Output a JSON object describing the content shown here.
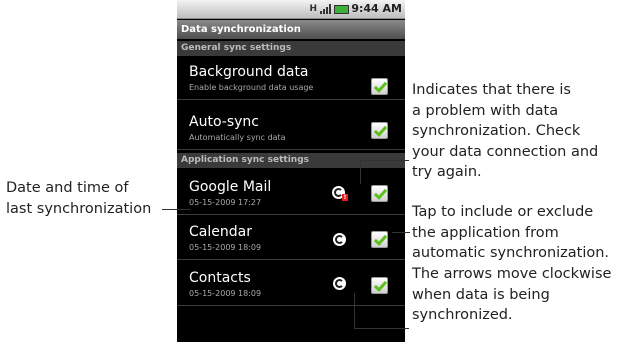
{
  "statusbar": {
    "network": "H",
    "time": "9:44 AM"
  },
  "titlebar": "Data synchronization",
  "sections": {
    "general": "General sync settings",
    "application": "Application sync settings"
  },
  "rows": [
    {
      "title": "Background data",
      "subtitle": "Enable background data usage",
      "checked": true
    },
    {
      "title": "Auto-sync",
      "subtitle": "Automatically sync data",
      "checked": true
    },
    {
      "title": "Google Mail",
      "subtitle": "05-15-2009 17:27",
      "checked": true,
      "sync_state": "error"
    },
    {
      "title": "Calendar",
      "subtitle": "05-15-2009 18:09",
      "checked": true,
      "sync_state": "ok"
    },
    {
      "title": "Contacts",
      "subtitle": "05-15-2009 18:09",
      "checked": true,
      "sync_state": "syncing"
    }
  ],
  "callouts": {
    "date_time": [
      "Date and time of",
      "last synchronization"
    ],
    "problem": [
      "Indicates that there is",
      "a problem with data",
      "synchronization. Check",
      "your data connection and",
      "try again."
    ],
    "include": [
      "Tap to include or exclude",
      "the application from",
      "automatic synchronization."
    ],
    "arrows": [
      "The arrows move clockwise",
      "when data is being",
      "synchronized."
    ]
  },
  "icons": {
    "sync": "sync-icon",
    "sync_error": "sync-error-icon",
    "checkbox": "checkbox-checked-icon"
  },
  "colors": {
    "check_green": "#5bbf1a",
    "error_red": "#e02020",
    "battery_green": "#3bb03b"
  }
}
